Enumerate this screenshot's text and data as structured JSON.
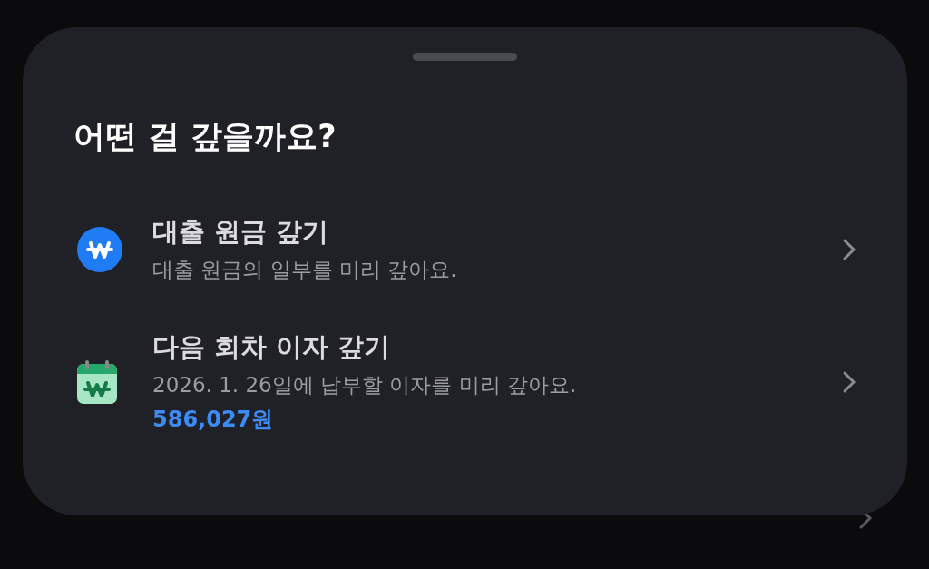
{
  "sheet": {
    "title": "어떤 걸 갚을까요?",
    "options": [
      {
        "kind": "principal",
        "title": "대출 원금 갚기",
        "description": "대출 원금의 일부를 미리 갚아요."
      },
      {
        "kind": "interest",
        "title": "다음 회차 이자 갚기",
        "description": "2026. 1. 26일에 납부할 이자를 미리 갚아요.",
        "amount": "586,027원"
      }
    ]
  }
}
